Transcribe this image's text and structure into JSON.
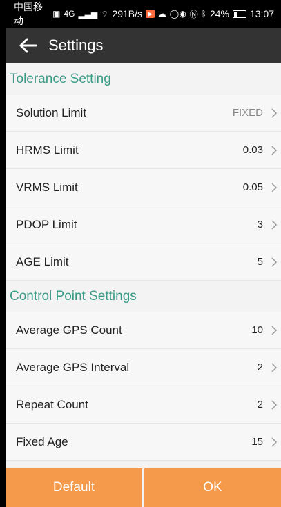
{
  "status_bar": {
    "carrier": "中国移动",
    "network": "4G",
    "speed": "291B/s",
    "battery": "24%",
    "time": "13:07"
  },
  "toolbar": {
    "title": "Settings"
  },
  "sections": [
    {
      "title": "Tolerance Setting",
      "items": [
        {
          "label": "Solution Limit",
          "value": "FIXED"
        },
        {
          "label": "HRMS Limit",
          "value": "0.03"
        },
        {
          "label": "VRMS Limit",
          "value": "0.05"
        },
        {
          "label": "PDOP Limit",
          "value": "3"
        },
        {
          "label": "AGE Limit",
          "value": "5"
        }
      ]
    },
    {
      "title": "Control Point Settings",
      "items": [
        {
          "label": "Average GPS Count",
          "value": "10"
        },
        {
          "label": "Average GPS Interval",
          "value": "2"
        },
        {
          "label": "Repeat Count",
          "value": "2"
        },
        {
          "label": "Fixed Age",
          "value": "15"
        }
      ]
    }
  ],
  "buttons": {
    "default_label": "Default",
    "ok_label": "OK"
  },
  "colors": {
    "accent": "#3a9b86",
    "button": "#f59a4a",
    "toolbar": "#333333"
  }
}
